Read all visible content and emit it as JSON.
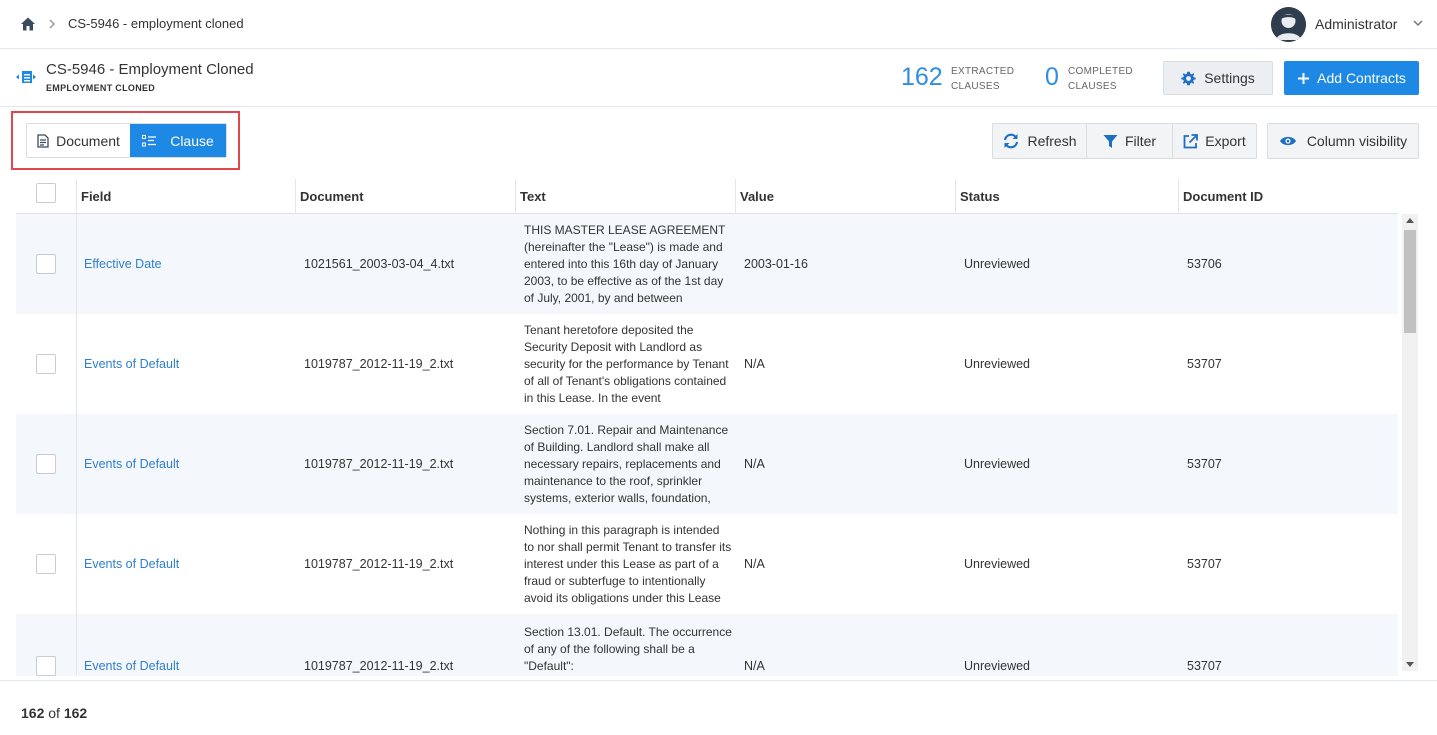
{
  "breadcrumb": {
    "current": "CS-5946 - employment cloned"
  },
  "user": {
    "name": "Administrator"
  },
  "project": {
    "title": "CS-5946 - Employment Cloned",
    "subtitle": "EMPLOYMENT CLONED"
  },
  "stats": {
    "extracted": {
      "value": "162",
      "label_line1": "EXTRACTED",
      "label_line2": "CLAUSES"
    },
    "completed": {
      "value": "0",
      "label_line1": "COMPLETED",
      "label_line2": "CLAUSES"
    }
  },
  "buttons": {
    "settings": "Settings",
    "add_contracts": "Add Contracts"
  },
  "view_toggle": {
    "document": "Document",
    "clause": "Clause",
    "active": "clause"
  },
  "toolbar": {
    "refresh": "Refresh",
    "filter": "Filter",
    "export": "Export",
    "column_visibility": "Column visibility"
  },
  "columns": [
    "Field",
    "Document",
    "Text",
    "Value",
    "Status",
    "Document ID"
  ],
  "rows": [
    {
      "field": "Effective Date",
      "document": "1021561_2003-03-04_4.txt",
      "text": "THIS MASTER LEASE AGREEMENT (hereinafter the \"Lease\") is made and entered into this 16th day of January 2003, to be effective as of the 1st day of July, 2001, by and between",
      "value": "2003-01-16",
      "status": "Unreviewed",
      "doc_id": "53706"
    },
    {
      "field": "Events of Default",
      "document": "1019787_2012-11-19_2.txt",
      "text": "Tenant heretofore deposited the Security Deposit with Landlord as security for the performance by Tenant of all of Tenant's obligations contained in this Lease. In the event",
      "value": "N/A",
      "status": "Unreviewed",
      "doc_id": "53707"
    },
    {
      "field": "Events of Default",
      "document": "1019787_2012-11-19_2.txt",
      "text": "Section 7.01. Repair and Maintenance of Building. Landlord shall make all necessary repairs, replacements and maintenance to the roof, sprinkler systems, exterior walls, foundation,",
      "value": "N/A",
      "status": "Unreviewed",
      "doc_id": "53707"
    },
    {
      "field": "Events of Default",
      "document": "1019787_2012-11-19_2.txt",
      "text": "Nothing in this paragraph is intended to nor shall permit Tenant to transfer its interest under this Lease as part of a fraud or subterfuge to intentionally avoid its obligations under this Lease",
      "value": "N/A",
      "status": "Unreviewed",
      "doc_id": "53707"
    },
    {
      "field": "Events of Default",
      "document": "1019787_2012-11-19_2.txt",
      "text": "Section 13.01. Default. The occurrence of any of the following shall be a \"Default\":",
      "value": "N/A",
      "status": "Unreviewed",
      "doc_id": "53707"
    }
  ],
  "footer": {
    "shown": "162",
    "of": "of",
    "total": "162"
  },
  "colors": {
    "accent": "#1e88e5",
    "link": "#2e7fd0",
    "highlight": "#e2474b"
  }
}
